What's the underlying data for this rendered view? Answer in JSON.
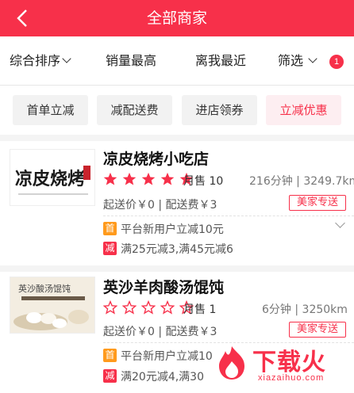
{
  "header": {
    "title": "全部商家",
    "back_icon": "back-arrow-icon"
  },
  "filters": {
    "sort": "综合排序",
    "sales": "销量最高",
    "distance": "离我最近",
    "filter": "筛选",
    "filter_count": "1"
  },
  "tags": [
    {
      "label": "首单立减",
      "active": false
    },
    {
      "label": "减配送费",
      "active": false
    },
    {
      "label": "进店领券",
      "active": false
    },
    {
      "label": "立减优惠",
      "active": true
    }
  ],
  "shops": [
    {
      "name": "凉皮烧烤小吃店",
      "logo_text": "凉皮烧烤",
      "rating_stars": 5,
      "sales": "月售 10",
      "time": "216分钟",
      "distance": "3249.7km",
      "min_order": "起送价￥0",
      "delivery_fee": "配送费￥3",
      "delivery_tag": "美家专送",
      "promos": [
        {
          "icon": "首",
          "text": "平台新用户立减10元"
        },
        {
          "icon": "减",
          "text": "满25元减3,满45元减6"
        }
      ]
    },
    {
      "name": "英沙羊肉酸汤馄饨",
      "logo_text": "英沙酸汤馄饨",
      "rating_stars": 0,
      "sales": "月售 1",
      "time": "6分钟",
      "distance": "3250km",
      "min_order": "起送价￥0",
      "delivery_fee": "配送费￥3",
      "delivery_tag": "美家专送",
      "promos": [
        {
          "icon": "首",
          "text": "平台新用户立减10"
        },
        {
          "icon": "减",
          "text": "满20元减4,满30"
        }
      ]
    }
  ],
  "watermark": {
    "text": "下载火",
    "url": "xiazaihuo.com"
  },
  "colors": {
    "accent": "#f7304a",
    "first_order": "#ff9a1c"
  }
}
